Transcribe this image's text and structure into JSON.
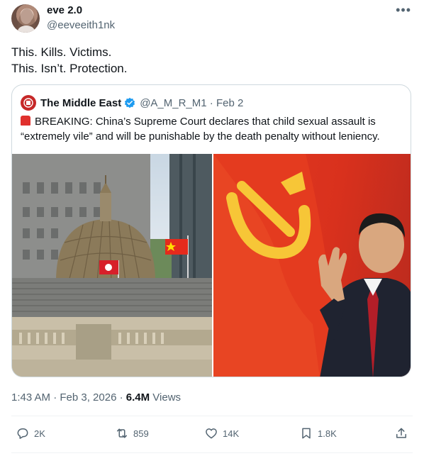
{
  "author": {
    "display_name": "eve 2.0",
    "handle": "@eeveeith1nk",
    "more_icon": "more-horizontal-icon"
  },
  "tweet": {
    "lines": [
      "This. Kills. Victims.",
      "This. Isn’t. Protection."
    ]
  },
  "quote": {
    "name": "The Middle East",
    "handle_and_date": "@A_M_R_M1 · Feb 2",
    "text_line1": "BREAKING: China’s Supreme Court declares that child sexual assault is",
    "text_line2": "“extremely vile” and will be punishable by the death penalty without leniency.",
    "siren_icon": "rotating-light-icon",
    "verified_color": "#1d9bf0"
  },
  "meta": {
    "time": "1:43 AM · Feb 3, 2026 · ",
    "views_count": "6.4M",
    "views_label": " Views"
  },
  "actions": {
    "replies": "2K",
    "reposts": "859",
    "likes": "14K",
    "bookmarks": "1.8K"
  },
  "colors": {
    "text": "#0f1419",
    "muted": "#536471",
    "border": "#cfd9de",
    "accent": "#1d9bf0"
  }
}
